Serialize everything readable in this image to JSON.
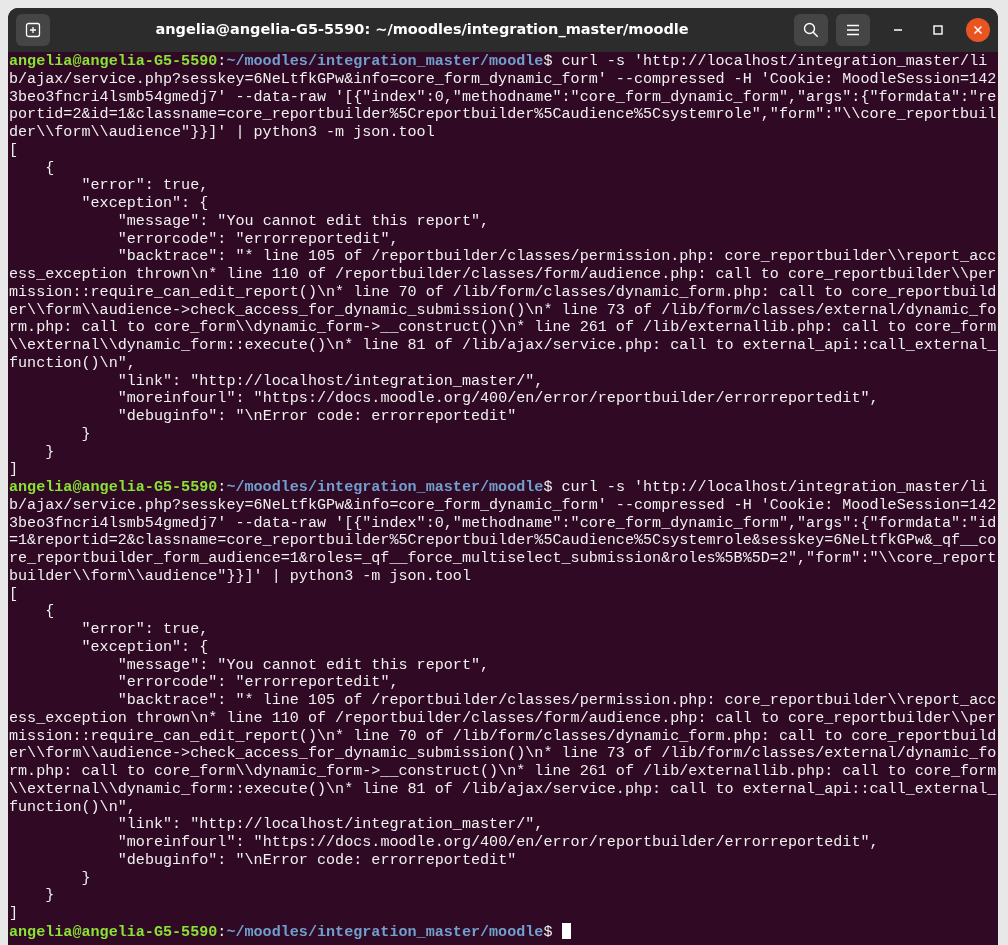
{
  "window": {
    "title": "angelia@angelia-G5-5590: ~/moodles/integration_master/moodle"
  },
  "terminal": {
    "lines": [
      {
        "kind": "prompt",
        "user_host": "angelia@angelia-G5-5590",
        "separator": ":",
        "path": "~/moodles/integration_master/moodle",
        "symbol": "$",
        "command": "curl -s 'http://localhost/integration_master/lib/ajax/service.php?sesskey=6NeLtfkGPw&info=core_form_dynamic_form' --compressed -H 'Cookie: MoodleSession=1423beo3fncri4lsmb54gmedj7' --data-raw '[{\"index\":0,\"methodname\":\"core_form_dynamic_form\",\"args\":{\"formdata\":\"reportid=2&id=1&classname=core_reportbuilder%5Creportbuilder%5Caudience%5Csystemrole\",\"form\":\"\\\\core_reportbuilder\\\\form\\\\audience\"}}]' | python3 -m json.tool"
      },
      {
        "kind": "output",
        "text": "["
      },
      {
        "kind": "output",
        "text": "    {"
      },
      {
        "kind": "output",
        "text": "        \"error\": true,"
      },
      {
        "kind": "output",
        "text": "        \"exception\": {"
      },
      {
        "kind": "output",
        "text": "            \"message\": \"You cannot edit this report\","
      },
      {
        "kind": "output",
        "text": "            \"errorcode\": \"errorreportedit\","
      },
      {
        "kind": "output",
        "text": "            \"backtrace\": \"* line 105 of /reportbuilder/classes/permission.php: core_reportbuilder\\\\report_access_exception thrown\\n* line 110 of /reportbuilder/classes/form/audience.php: call to core_reportbuilder\\\\permission::require_can_edit_report()\\n* line 70 of /lib/form/classes/dynamic_form.php: call to core_reportbuilder\\\\form\\\\audience->check_access_for_dynamic_submission()\\n* line 73 of /lib/form/classes/external/dynamic_form.php: call to core_form\\\\dynamic_form->__construct()\\n* line 261 of /lib/externallib.php: call to core_form\\\\external\\\\dynamic_form::execute()\\n* line 81 of /lib/ajax/service.php: call to external_api::call_external_function()\\n\","
      },
      {
        "kind": "output",
        "text": "            \"link\": \"http://localhost/integration_master/\","
      },
      {
        "kind": "output",
        "text": "            \"moreinfourl\": \"https://docs.moodle.org/400/en/error/reportbuilder/errorreportedit\","
      },
      {
        "kind": "output",
        "text": "            \"debuginfo\": \"\\nError code: errorreportedit\""
      },
      {
        "kind": "output",
        "text": "        }"
      },
      {
        "kind": "output",
        "text": "    }"
      },
      {
        "kind": "output",
        "text": "]"
      },
      {
        "kind": "prompt",
        "user_host": "angelia@angelia-G5-5590",
        "separator": ":",
        "path": "~/moodles/integration_master/moodle",
        "symbol": "$",
        "command": "curl -s 'http://localhost/integration_master/lib/ajax/service.php?sesskey=6NeLtfkGPw&info=core_form_dynamic_form' --compressed -H 'Cookie: MoodleSession=1423beo3fncri4lsmb54gmedj7' --data-raw '[{\"index\":0,\"methodname\":\"core_form_dynamic_form\",\"args\":{\"formdata\":\"id=1&reportid=2&classname=core_reportbuilder%5Creportbuilder%5Caudience%5Csystemrole&sesskey=6NeLtfkGPw&_qf__core_reportbuilder_form_audience=1&roles=_qf__force_multiselect_submission&roles%5B%5D=2\",\"form\":\"\\\\core_reportbuilder\\\\form\\\\audience\"}}]' | python3 -m json.tool"
      },
      {
        "kind": "output",
        "text": "["
      },
      {
        "kind": "output",
        "text": "    {"
      },
      {
        "kind": "output",
        "text": "        \"error\": true,"
      },
      {
        "kind": "output",
        "text": "        \"exception\": {"
      },
      {
        "kind": "output",
        "text": "            \"message\": \"You cannot edit this report\","
      },
      {
        "kind": "output",
        "text": "            \"errorcode\": \"errorreportedit\","
      },
      {
        "kind": "output",
        "text": "            \"backtrace\": \"* line 105 of /reportbuilder/classes/permission.php: core_reportbuilder\\\\report_access_exception thrown\\n* line 110 of /reportbuilder/classes/form/audience.php: call to core_reportbuilder\\\\permission::require_can_edit_report()\\n* line 70 of /lib/form/classes/dynamic_form.php: call to core_reportbuilder\\\\form\\\\audience->check_access_for_dynamic_submission()\\n* line 73 of /lib/form/classes/external/dynamic_form.php: call to core_form\\\\dynamic_form->__construct()\\n* line 261 of /lib/externallib.php: call to core_form\\\\external\\\\dynamic_form::execute()\\n* line 81 of /lib/ajax/service.php: call to external_api::call_external_function()\\n\","
      },
      {
        "kind": "output",
        "text": "            \"link\": \"http://localhost/integration_master/\","
      },
      {
        "kind": "output",
        "text": "            \"moreinfourl\": \"https://docs.moodle.org/400/en/error/reportbuilder/errorreportedit\","
      },
      {
        "kind": "output",
        "text": "            \"debuginfo\": \"\\nError code: errorreportedit\""
      },
      {
        "kind": "output",
        "text": "        }"
      },
      {
        "kind": "output",
        "text": "    }"
      },
      {
        "kind": "output",
        "text": "]"
      },
      {
        "kind": "prompt",
        "user_host": "angelia@angelia-G5-5590",
        "separator": ":",
        "path": "~/moodles/integration_master/moodle",
        "symbol": "$"
      }
    ]
  }
}
